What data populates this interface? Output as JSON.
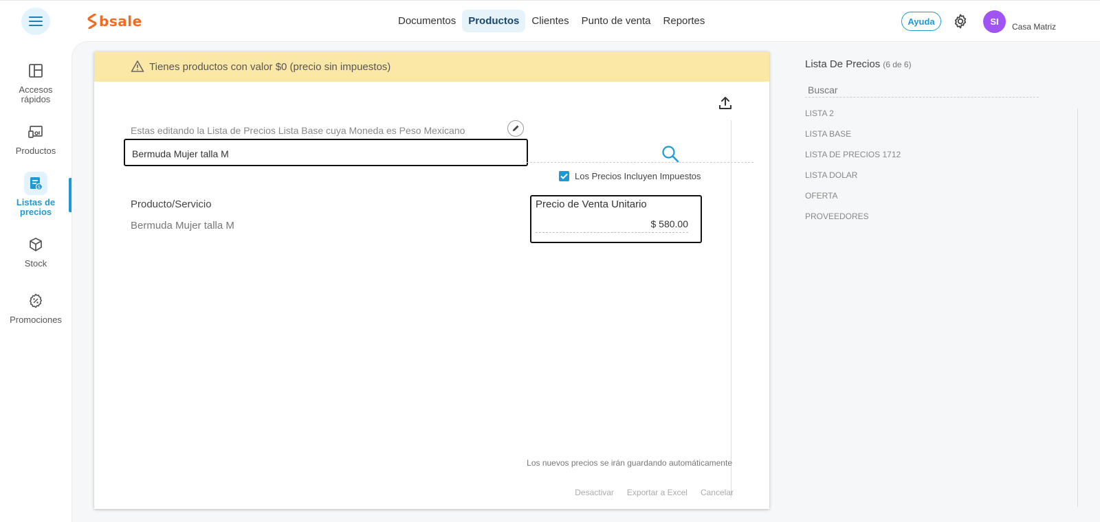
{
  "header": {
    "logo_text": "bsale",
    "nav": [
      {
        "label": "Documentos",
        "active": false
      },
      {
        "label": "Productos",
        "active": true
      },
      {
        "label": "Clientes",
        "active": false
      },
      {
        "label": "Punto de venta",
        "active": false
      },
      {
        "label": "Reportes",
        "active": false
      }
    ],
    "help_label": "Ayuda",
    "avatar_initials": "SI",
    "branch": "Casa Matriz",
    "colors": {
      "brand": "#f26b21",
      "accent": "#1c9ad6",
      "avatar": "#a054f2"
    }
  },
  "sidebar": {
    "items": [
      {
        "label": "Accesos rápidos",
        "icon": "layout-icon"
      },
      {
        "label": "Productos",
        "icon": "products-icon"
      },
      {
        "label": "Listas de precios",
        "icon": "price-list-icon",
        "active": true
      },
      {
        "label": "Stock",
        "icon": "box-icon"
      },
      {
        "label": "Promociones",
        "icon": "discount-icon"
      }
    ]
  },
  "main": {
    "banner": "Tienes productos con valor $0 (precio sin impuestos)",
    "edit_label": "Estas editando la Lista de Precios Lista Base cuya Moneda es Peso Mexicano",
    "search_value": "Bermuda Mujer talla M",
    "checkbox_label": "Los Precios Incluyen Impuestos",
    "checkbox_checked": true,
    "columns": {
      "product": "Producto/Servicio",
      "price": "Precio de Venta Unitario"
    },
    "rows": [
      {
        "product": "Bermuda Mujer talla M",
        "price": "$ 580.00"
      }
    ],
    "autosave_note": "Los nuevos precios se irán guardando automáticamente",
    "actions": {
      "deactivate": "Desactivar",
      "export": "Exportar a Excel",
      "cancel": "Cancelar"
    }
  },
  "right_panel": {
    "title": "Lista De Precios",
    "count": "(6 de 6)",
    "search_placeholder": "Buscar",
    "lists": [
      "LISTA 2",
      "LISTA BASE",
      "LISTA DE PRECIOS 1712",
      "LISTA DOLAR",
      "OFERTA",
      "PROVEEDORES"
    ]
  }
}
